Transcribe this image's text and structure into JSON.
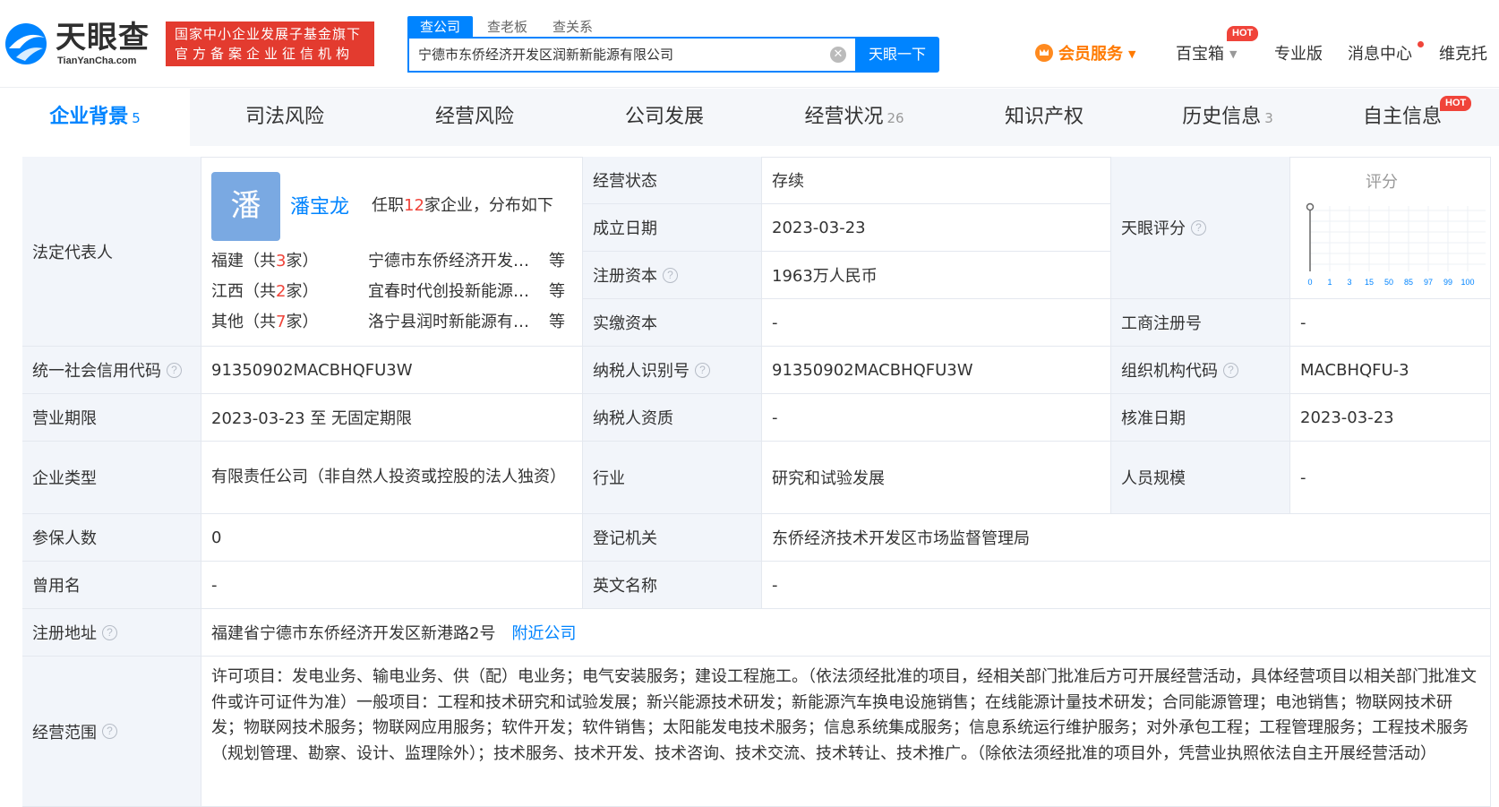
{
  "brand": {
    "name_cn": "天眼查",
    "name_en": "TianYanCha.com",
    "gov_line1": "国家中小企业发展子基金旗下",
    "gov_line2": "官方备案企业征信机构"
  },
  "search": {
    "tabs": [
      "查公司",
      "查老板",
      "查关系"
    ],
    "value": "宁德市东侨经济开发区润新新能源有限公司",
    "button": "天眼一下"
  },
  "topnav": {
    "vip": "会员服务",
    "baibaoxiang": "百宝箱",
    "hot": "HOT",
    "pro": "专业版",
    "messages": "消息中心",
    "user": "维克托"
  },
  "tabs": [
    {
      "label": "企业背景",
      "count": "5"
    },
    {
      "label": "司法风险",
      "count": ""
    },
    {
      "label": "经营风险",
      "count": ""
    },
    {
      "label": "公司发展",
      "count": ""
    },
    {
      "label": "经营状况",
      "count": "26"
    },
    {
      "label": "知识产权",
      "count": ""
    },
    {
      "label": "历史信息",
      "count": "3"
    },
    {
      "label": "自主信息",
      "count": ""
    }
  ],
  "tab_hot": "HOT",
  "info": {
    "legal_rep_label": "法定代表人",
    "rep_avatar": "潘",
    "rep_name": "潘宝龙",
    "rep_pre": "任职",
    "rep_count": "12",
    "rep_post": "家企业，分布如下",
    "rep_regions": [
      {
        "region_pre": "福建（共",
        "n": "3",
        "region_post": "家）",
        "company": "宁德市东侨经济开发…",
        "more": "等"
      },
      {
        "region_pre": "江西（共",
        "n": "2",
        "region_post": "家）",
        "company": "宜春时代创投新能源…",
        "more": "等"
      },
      {
        "region_pre": "其他（共",
        "n": "7",
        "region_post": "家）",
        "company": "洛宁县润时新能源有…",
        "more": "等"
      }
    ],
    "status_label": "经营状态",
    "status": "存续",
    "found_label": "成立日期",
    "found": "2023-03-23",
    "capital_label": "注册资本",
    "capital": "1963万人民币",
    "paid_label": "实缴资本",
    "paid": "-",
    "score_label": "天眼评分",
    "score_title": "评分",
    "score_ticks": [
      "0",
      "1",
      "3",
      "15",
      "50",
      "85",
      "97",
      "99",
      "100"
    ],
    "bizreg_label": "工商注册号",
    "bizreg": "-",
    "credit_label": "统一社会信用代码",
    "credit": "91350902MACBHQFU3W",
    "tax_label": "纳税人识别号",
    "tax": "91350902MACBHQFU3W",
    "org_label": "组织机构代码",
    "org": "MACBHQFU-3",
    "term_label": "营业期限",
    "term": "2023-03-23 至 无固定期限",
    "taxq_label": "纳税人资质",
    "taxq": "-",
    "approve_label": "核准日期",
    "approve": "2023-03-23",
    "type_label": "企业类型",
    "type": "有限责任公司（非自然人投资或控股的法人独资）",
    "industry_label": "行业",
    "industry": "研究和试验发展",
    "staff_label": "人员规模",
    "staff": "-",
    "insured_label": "参保人数",
    "insured": "0",
    "authority_label": "登记机关",
    "authority": "东侨经济技术开发区市场监督管理局",
    "former_label": "曾用名",
    "former": "-",
    "en_label": "英文名称",
    "en": "-",
    "addr_label": "注册地址",
    "addr": "福建省宁德市东侨经济开发区新港路2号",
    "addr_link": "附近公司",
    "scope_label": "经营范围",
    "scope": "许可项目：发电业务、输电业务、供（配）电业务；电气安装服务；建设工程施工。（依法须经批准的项目，经相关部门批准后方可开展经营活动，具体经营项目以相关部门批准文件或许可证件为准）一般项目：工程和技术研究和试验发展；新兴能源技术研发；新能源汽车换电设施销售；在线能源计量技术研发；合同能源管理；电池销售；物联网技术研发；物联网技术服务；物联网应用服务；软件开发；软件销售；太阳能发电技术服务；信息系统集成服务；信息系统运行维护服务；对外承包工程；工程管理服务；工程技术服务（规划管理、勘察、设计、监理除外）；技术服务、技术开发、技术咨询、技术交流、技术转让、技术推广。（除依法须经批准的项目外，凭营业执照依法自主开展经营活动）"
  },
  "colors": {
    "accent": "#0084ff",
    "hot": "#f0443a",
    "vip": "#ff7a00",
    "gov": "#e33b2f",
    "label_bg": "#f2f5fa"
  }
}
